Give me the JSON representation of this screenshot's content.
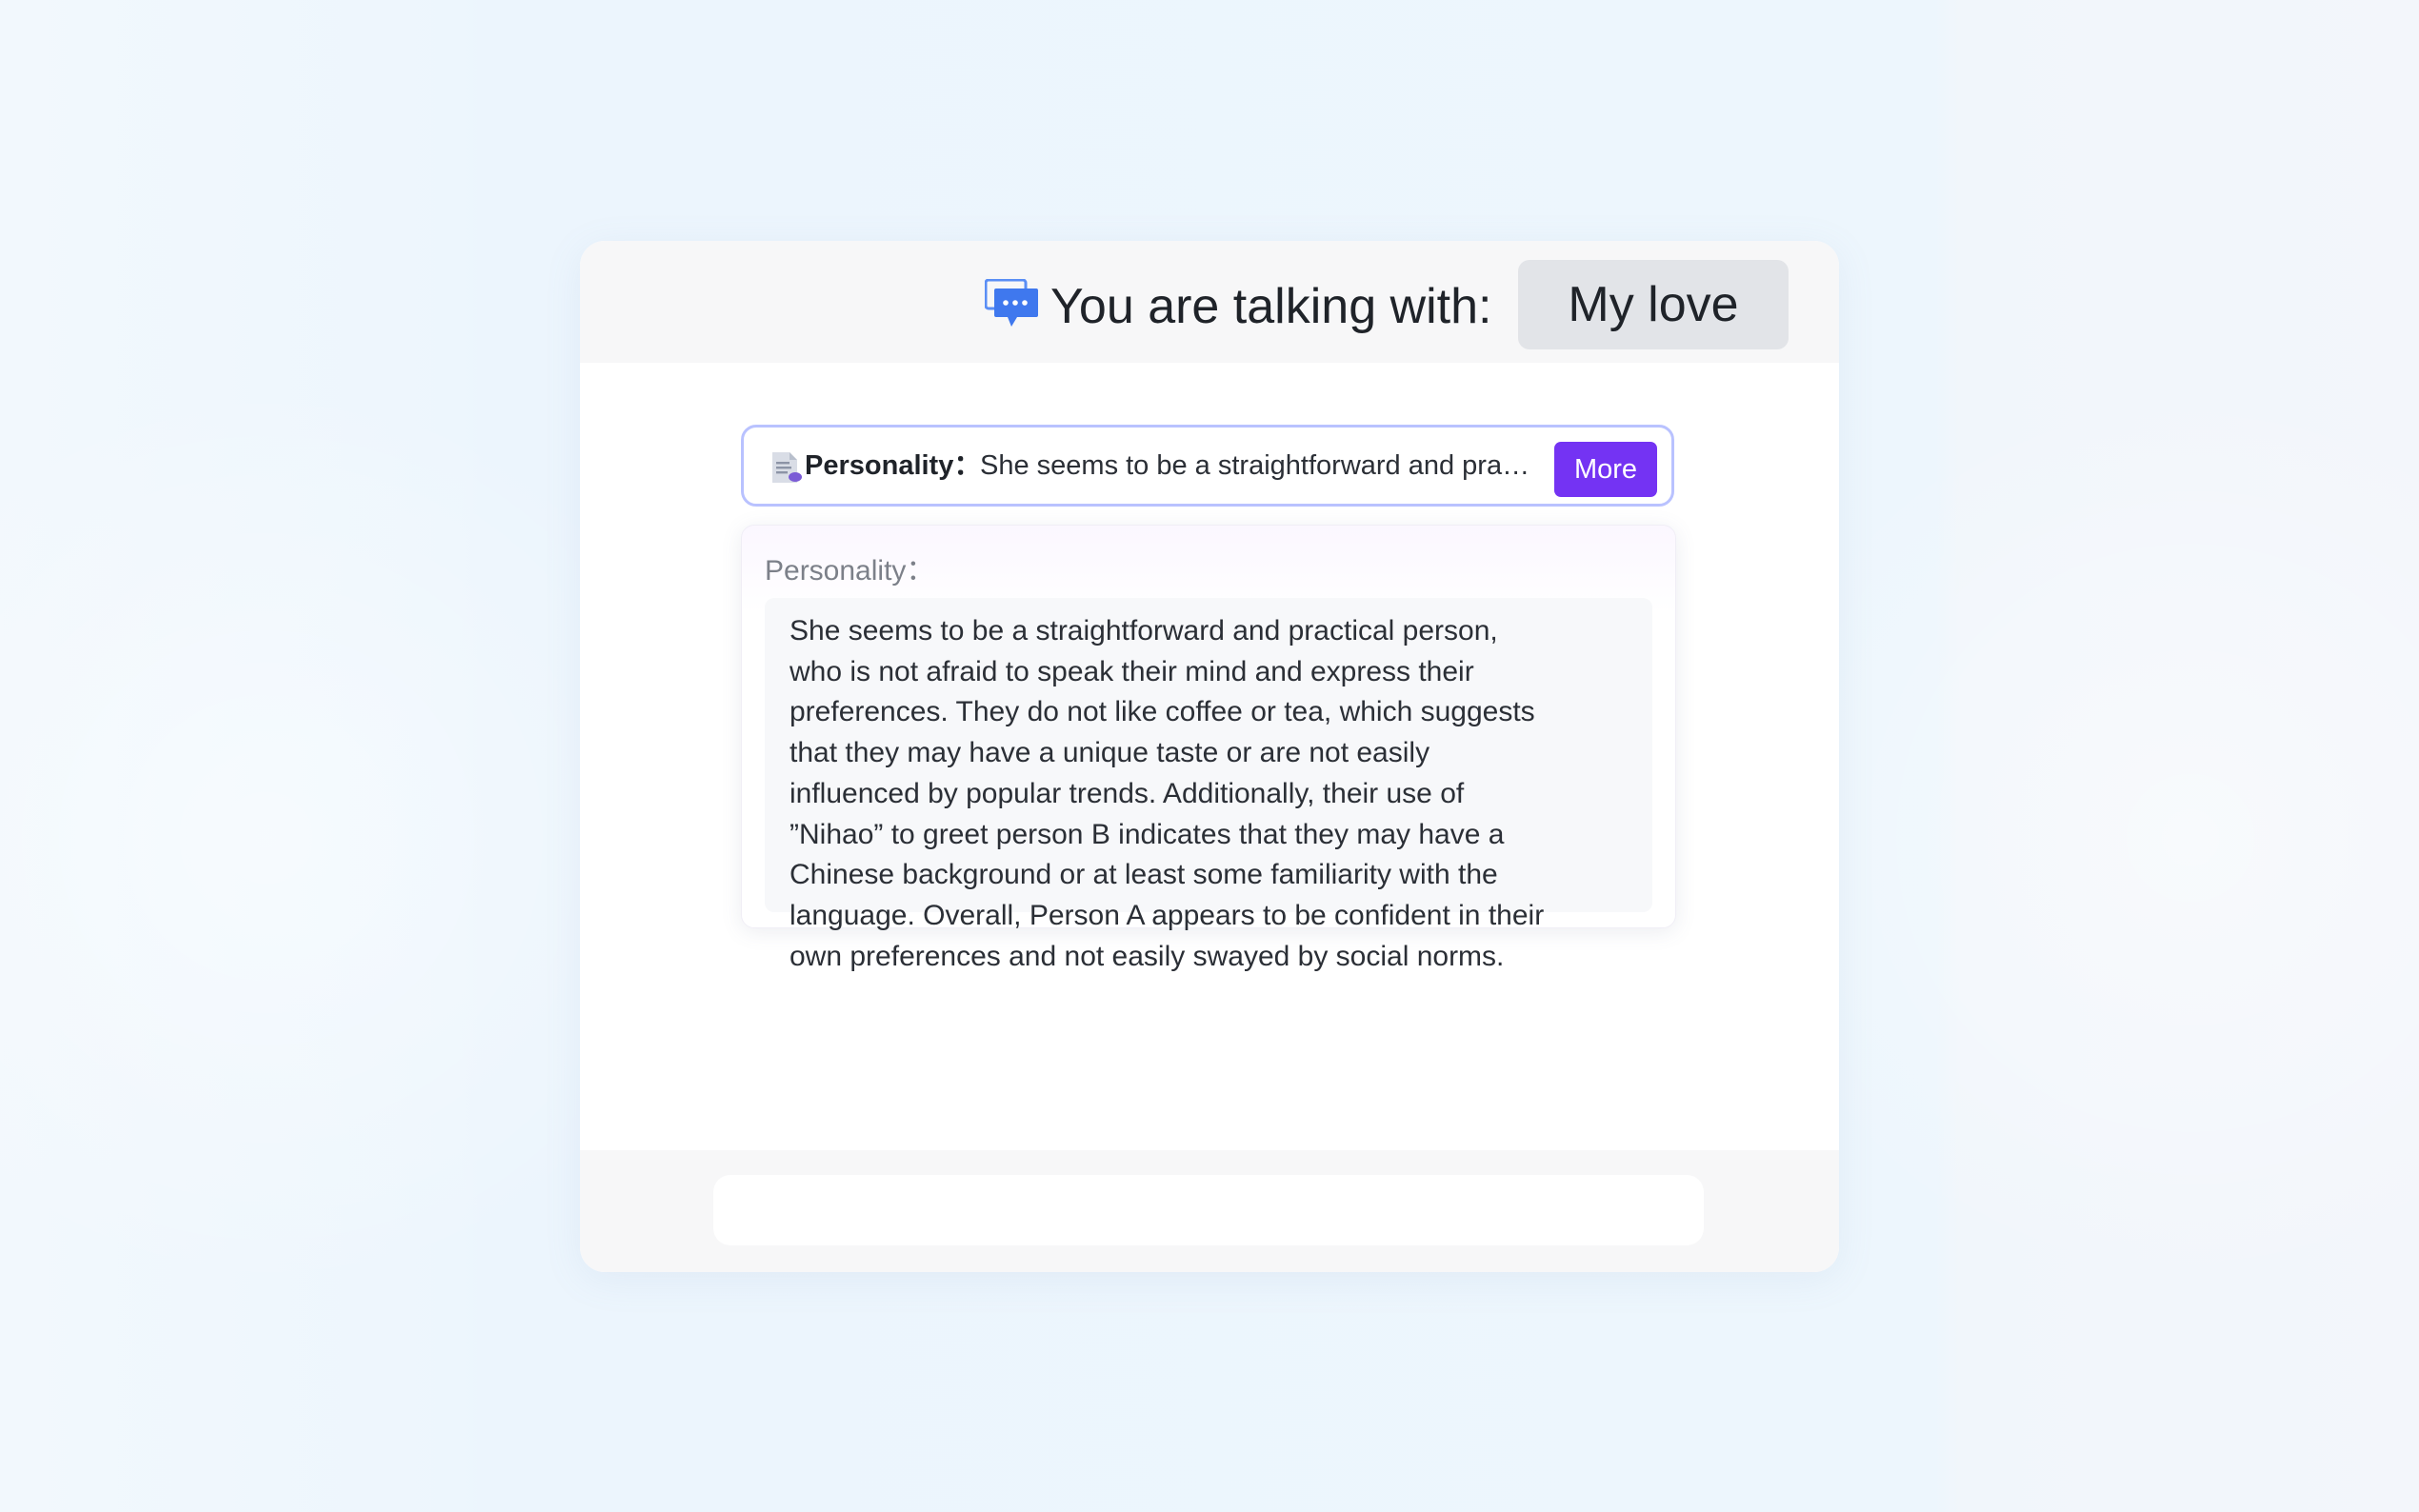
{
  "header": {
    "talking_label": "You are talking with:",
    "contact_name": "My love",
    "icon": "chat-bubbles-icon"
  },
  "summary": {
    "icon": "document-icon",
    "label": "Personality：",
    "text": "She seems to be a straightforward and practical person, who is not afraid to speak their mind and express their preferences.",
    "more_label": "More"
  },
  "detail": {
    "label": "Personality：",
    "lines": [
      "She seems to be a straightforward and practical person,",
      "who is not afraid to speak their mind and express their",
      "preferences. They do not like coffee or tea, which suggests",
      "that they may have a unique taste or are not easily",
      "influenced by popular trends. Additionally, their use of",
      "”Nihao” to greet person B indicates that they may have a",
      "Chinese background or at least some familiarity with the",
      "language. Overall, Person A appears to be confident in their",
      "own preferences and not easily swayed by social norms."
    ]
  },
  "footer": {
    "input_value": "",
    "input_placeholder": ""
  },
  "colors": {
    "accent": "#7433f3",
    "summary_border": "#b9c2ff",
    "icon_blue": "#4a7df0"
  }
}
